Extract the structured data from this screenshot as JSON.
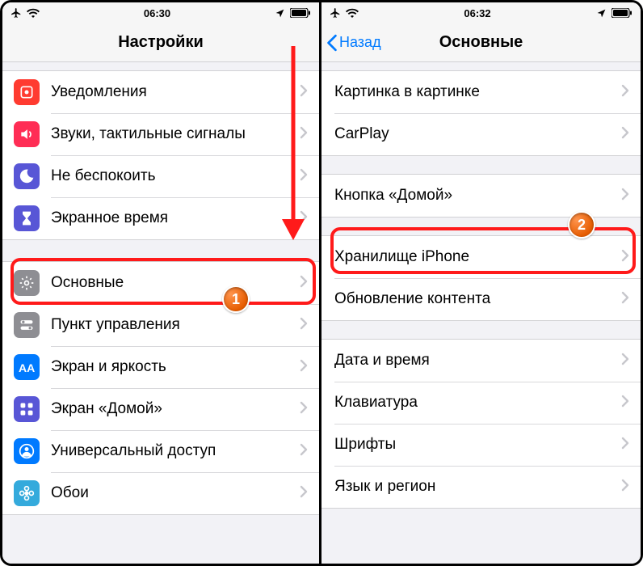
{
  "left": {
    "status_time": "06:30",
    "title": "Настройки",
    "rows_a": [
      {
        "name": "notifications",
        "label": "Уведомления",
        "icon": "bell",
        "bg": "bg-red"
      },
      {
        "name": "sounds",
        "label": "Звуки, тактильные сигналы",
        "icon": "speaker",
        "bg": "bg-pink"
      },
      {
        "name": "dnd",
        "label": "Не беспокоить",
        "icon": "moon",
        "bg": "bg-purple"
      },
      {
        "name": "screentime",
        "label": "Экранное время",
        "icon": "hourglass",
        "bg": "bg-purple"
      }
    ],
    "rows_b": [
      {
        "name": "general",
        "label": "Основные",
        "icon": "gear",
        "bg": "bg-grey"
      },
      {
        "name": "control-center",
        "label": "Пункт управления",
        "icon": "switches",
        "bg": "bg-grey2"
      },
      {
        "name": "display",
        "label": "Экран и яркость",
        "icon": "aa",
        "bg": "bg-blue"
      },
      {
        "name": "home-screen",
        "label": "Экран «Домой»",
        "icon": "grid",
        "bg": "bg-indigo"
      },
      {
        "name": "accessibility",
        "label": "Универсальный доступ",
        "icon": "person",
        "bg": "bg-blue"
      },
      {
        "name": "wallpaper",
        "label": "Обои",
        "icon": "flower",
        "bg": "bg-teal"
      }
    ]
  },
  "right": {
    "status_time": "06:32",
    "back_label": "Назад",
    "title": "Основные",
    "rows_a": [
      {
        "name": "pip",
        "label": "Картинка в картинке"
      },
      {
        "name": "carplay",
        "label": "CarPlay"
      }
    ],
    "rows_b": [
      {
        "name": "home-button",
        "label": "Кнопка «Домой»"
      }
    ],
    "rows_c": [
      {
        "name": "storage",
        "label": "Хранилище iPhone"
      },
      {
        "name": "background-refresh",
        "label": "Обновление контента"
      }
    ],
    "rows_d": [
      {
        "name": "date-time",
        "label": "Дата и время"
      },
      {
        "name": "keyboard",
        "label": "Клавиатура"
      },
      {
        "name": "fonts",
        "label": "Шрифты"
      },
      {
        "name": "language-region",
        "label": "Язык и регион"
      }
    ]
  },
  "annotations": {
    "badge1": "1",
    "badge2": "2"
  }
}
